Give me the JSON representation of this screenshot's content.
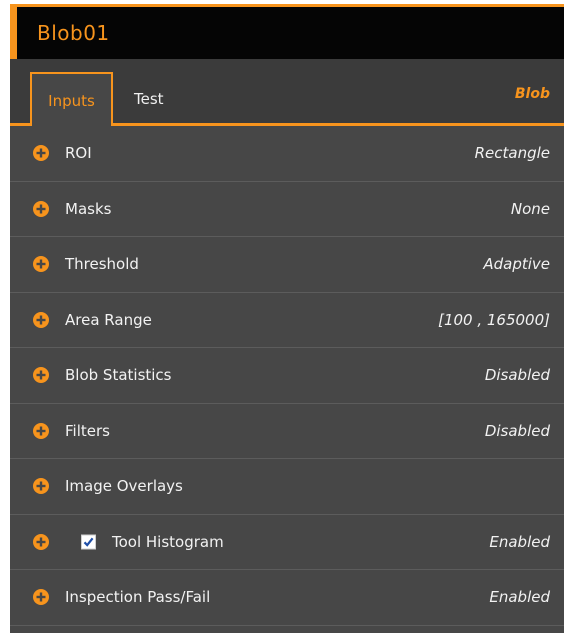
{
  "tool": {
    "title": "Blob01",
    "type": "Blob"
  },
  "tabs": [
    {
      "label": "Inputs",
      "active": true
    },
    {
      "label": "Test",
      "active": false
    }
  ],
  "colors": {
    "accent": "#f7941d",
    "panel_bg": "#474747",
    "title_bg": "#050505",
    "text": "#f2f2f2",
    "checkmark": "#1f4fa8"
  },
  "icons": {
    "expand": "plus-circle-icon",
    "check": "checkmark-icon"
  },
  "rows": [
    {
      "label": "ROI",
      "value": "Rectangle"
    },
    {
      "label": "Masks",
      "value": "None"
    },
    {
      "label": "Threshold",
      "value": "Adaptive"
    },
    {
      "label": "Area Range",
      "value": "[100 , 165000]"
    },
    {
      "label": "Blob Statistics",
      "value": "Disabled"
    },
    {
      "label": "Filters",
      "value": "Disabled"
    },
    {
      "label": "Image Overlays",
      "value": ""
    },
    {
      "label": "Tool Histogram",
      "value": "Enabled",
      "checkbox": true,
      "checked": true
    },
    {
      "label": "Inspection Pass/Fail",
      "value": "Enabled"
    }
  ]
}
